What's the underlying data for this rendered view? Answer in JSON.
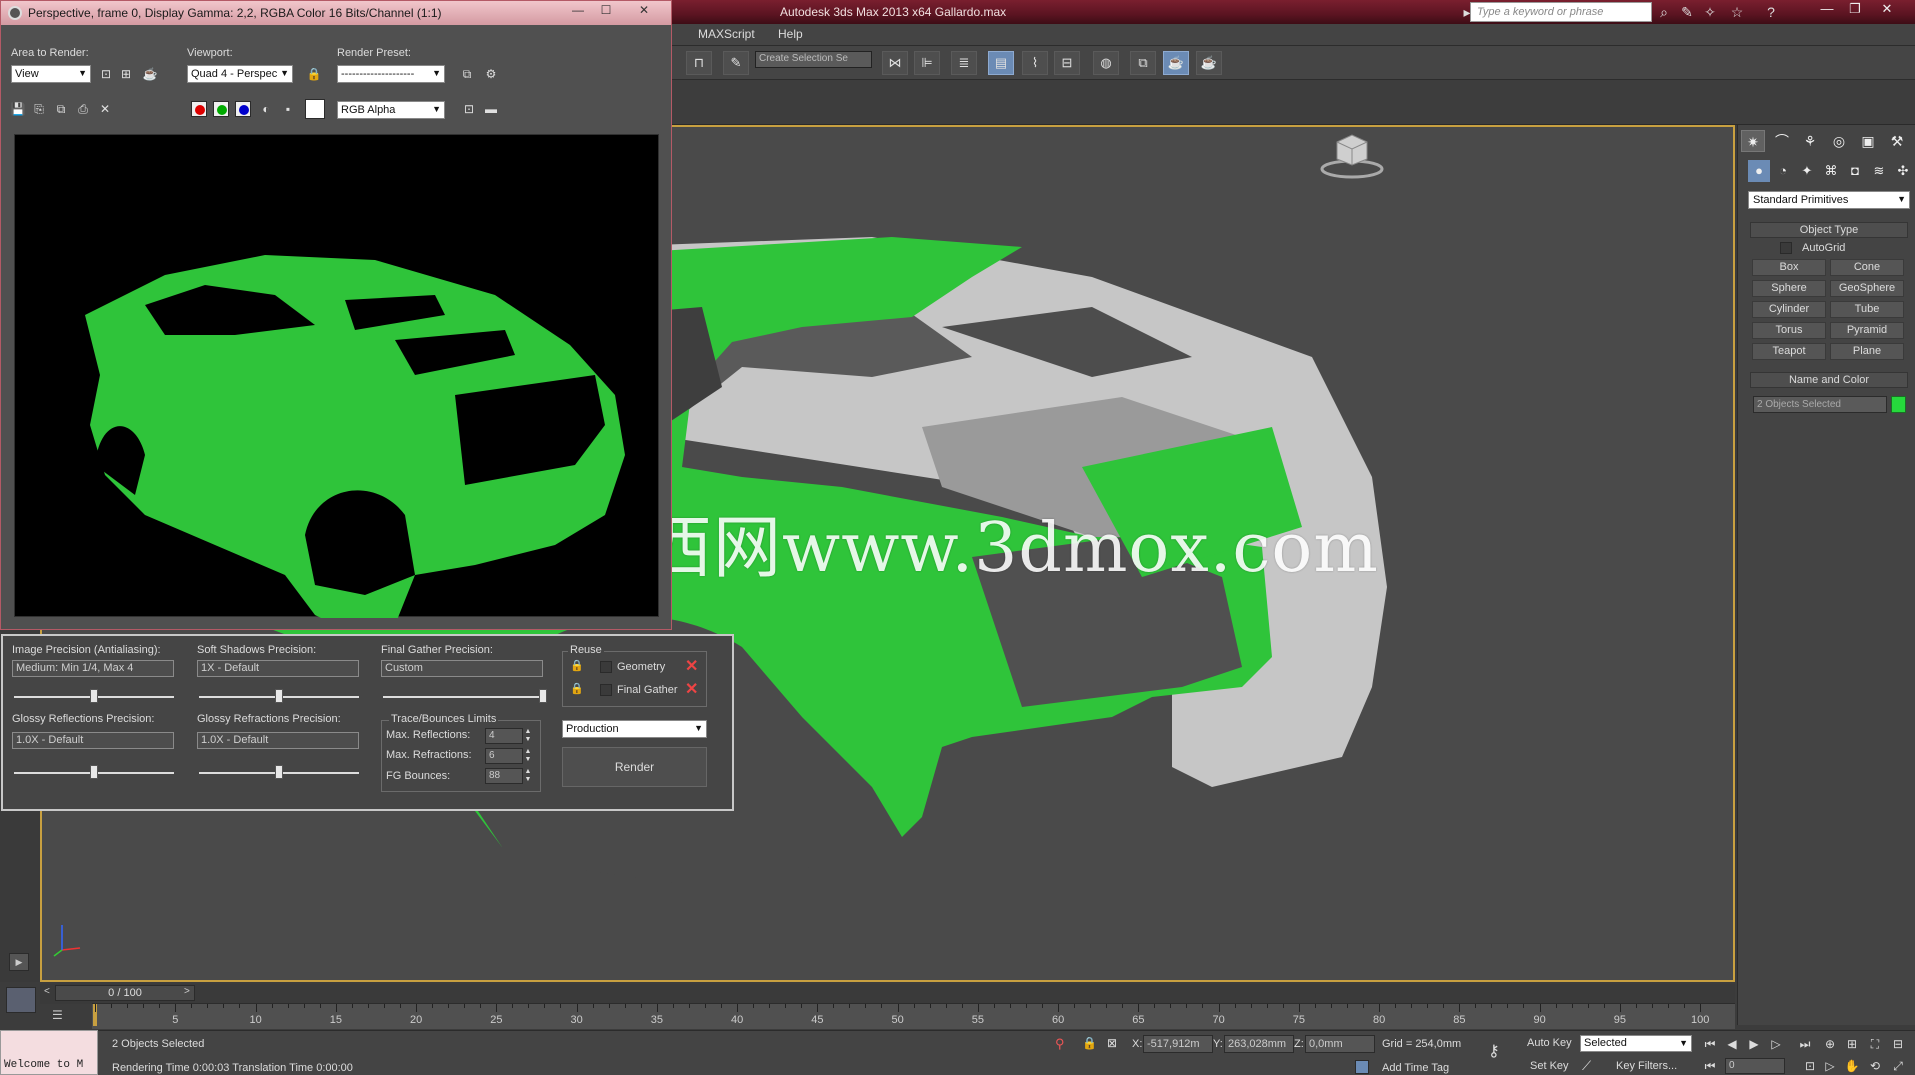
{
  "app": {
    "title": "Autodesk 3ds Max  2013 x64     Gallardo.max",
    "search_placeholder": "Type a keyword or phrase"
  },
  "menu": [
    "MAXScript",
    "Help"
  ],
  "toolbar": {
    "selection_set_placeholder": "Create Selection Se"
  },
  "frame_window": {
    "title": "Perspective, frame 0, Display Gamma: 2,2, RGBA Color 16 Bits/Channel (1:1)",
    "area_to_render_label": "Area to Render:",
    "area_to_render_value": "View",
    "viewport_label": "Viewport:",
    "viewport_value": "Quad 4 - Perspec",
    "render_preset_label": "Render Preset:",
    "render_preset_value": "--------------------",
    "channel_value": "RGB Alpha"
  },
  "render_panel": {
    "image_precision_label": "Image Precision (Antialiasing):",
    "image_precision_value": "Medium: Min 1/4, Max 4",
    "image_precision_level": 0.5,
    "soft_shadows_label": "Soft Shadows Precision:",
    "soft_shadows_value": "1X - Default",
    "soft_shadows_level": 0.5,
    "final_gather_label": "Final Gather Precision:",
    "final_gather_value": "Custom",
    "final_gather_level": 1.0,
    "glossy_reflections_label": "Glossy Reflections Precision:",
    "glossy_reflections_value": "1.0X - Default",
    "glossy_reflections_level": 0.5,
    "glossy_refractions_label": "Glossy Refractions Precision:",
    "glossy_refractions_value": "1.0X - Default",
    "glossy_refractions_level": 0.5,
    "trace_group_label": "Trace/Bounces Limits",
    "max_reflections_label": "Max. Reflections:",
    "max_reflections_value": "4",
    "max_refractions_label": "Max. Refractions:",
    "max_refractions_value": "6",
    "fg_bounces_label": "FG Bounces:",
    "fg_bounces_value": "88",
    "reuse_label": "Reuse",
    "geometry_label": "Geometry",
    "final_gather_reuse_label": "Final Gather",
    "mode_value": "Production",
    "render_button": "Render"
  },
  "watermark": "莫西网www.3dmox.com",
  "command_panel": {
    "category": "Standard Primitives",
    "object_type_title": "Object Type",
    "autogrid_label": "AutoGrid",
    "primitives": [
      "Box",
      "Cone",
      "Sphere",
      "GeoSphere",
      "Cylinder",
      "Tube",
      "Torus",
      "Pyramid",
      "Teapot",
      "Plane"
    ],
    "name_color_title": "Name and Color",
    "object_name": "2 Objects Selected",
    "object_color": "#26d93c"
  },
  "timeline": {
    "frame_display": "0 / 100",
    "ticks": [
      "5",
      "10",
      "15",
      "20",
      "25",
      "30",
      "35",
      "40",
      "45",
      "50",
      "55",
      "60",
      "65",
      "70",
      "75",
      "80",
      "85",
      "90",
      "95",
      "100"
    ]
  },
  "status": {
    "listener_text": "Welcome to M",
    "selection_text": "2 Objects Selected",
    "prompt_text": "Rendering Time  0:00:03      Translation Time  0:00:00",
    "x_label": "X:",
    "x_value": "-517,912m",
    "y_label": "Y:",
    "y_value": "263,028mm",
    "z_label": "Z:",
    "z_value": "0,0mm",
    "grid_text": "Grid = 254,0mm",
    "add_time_tag": "Add Time Tag",
    "auto_key": "Auto Key",
    "set_key": "Set Key",
    "selected_value": "Selected",
    "key_filters": "Key Filters...",
    "frame_field": "0"
  },
  "colors": {
    "car_green": "#2fc43a",
    "car_gray": "#c9c9c9",
    "viewport_bg": "#4a4a4a",
    "title_bar": "#5b1421"
  }
}
